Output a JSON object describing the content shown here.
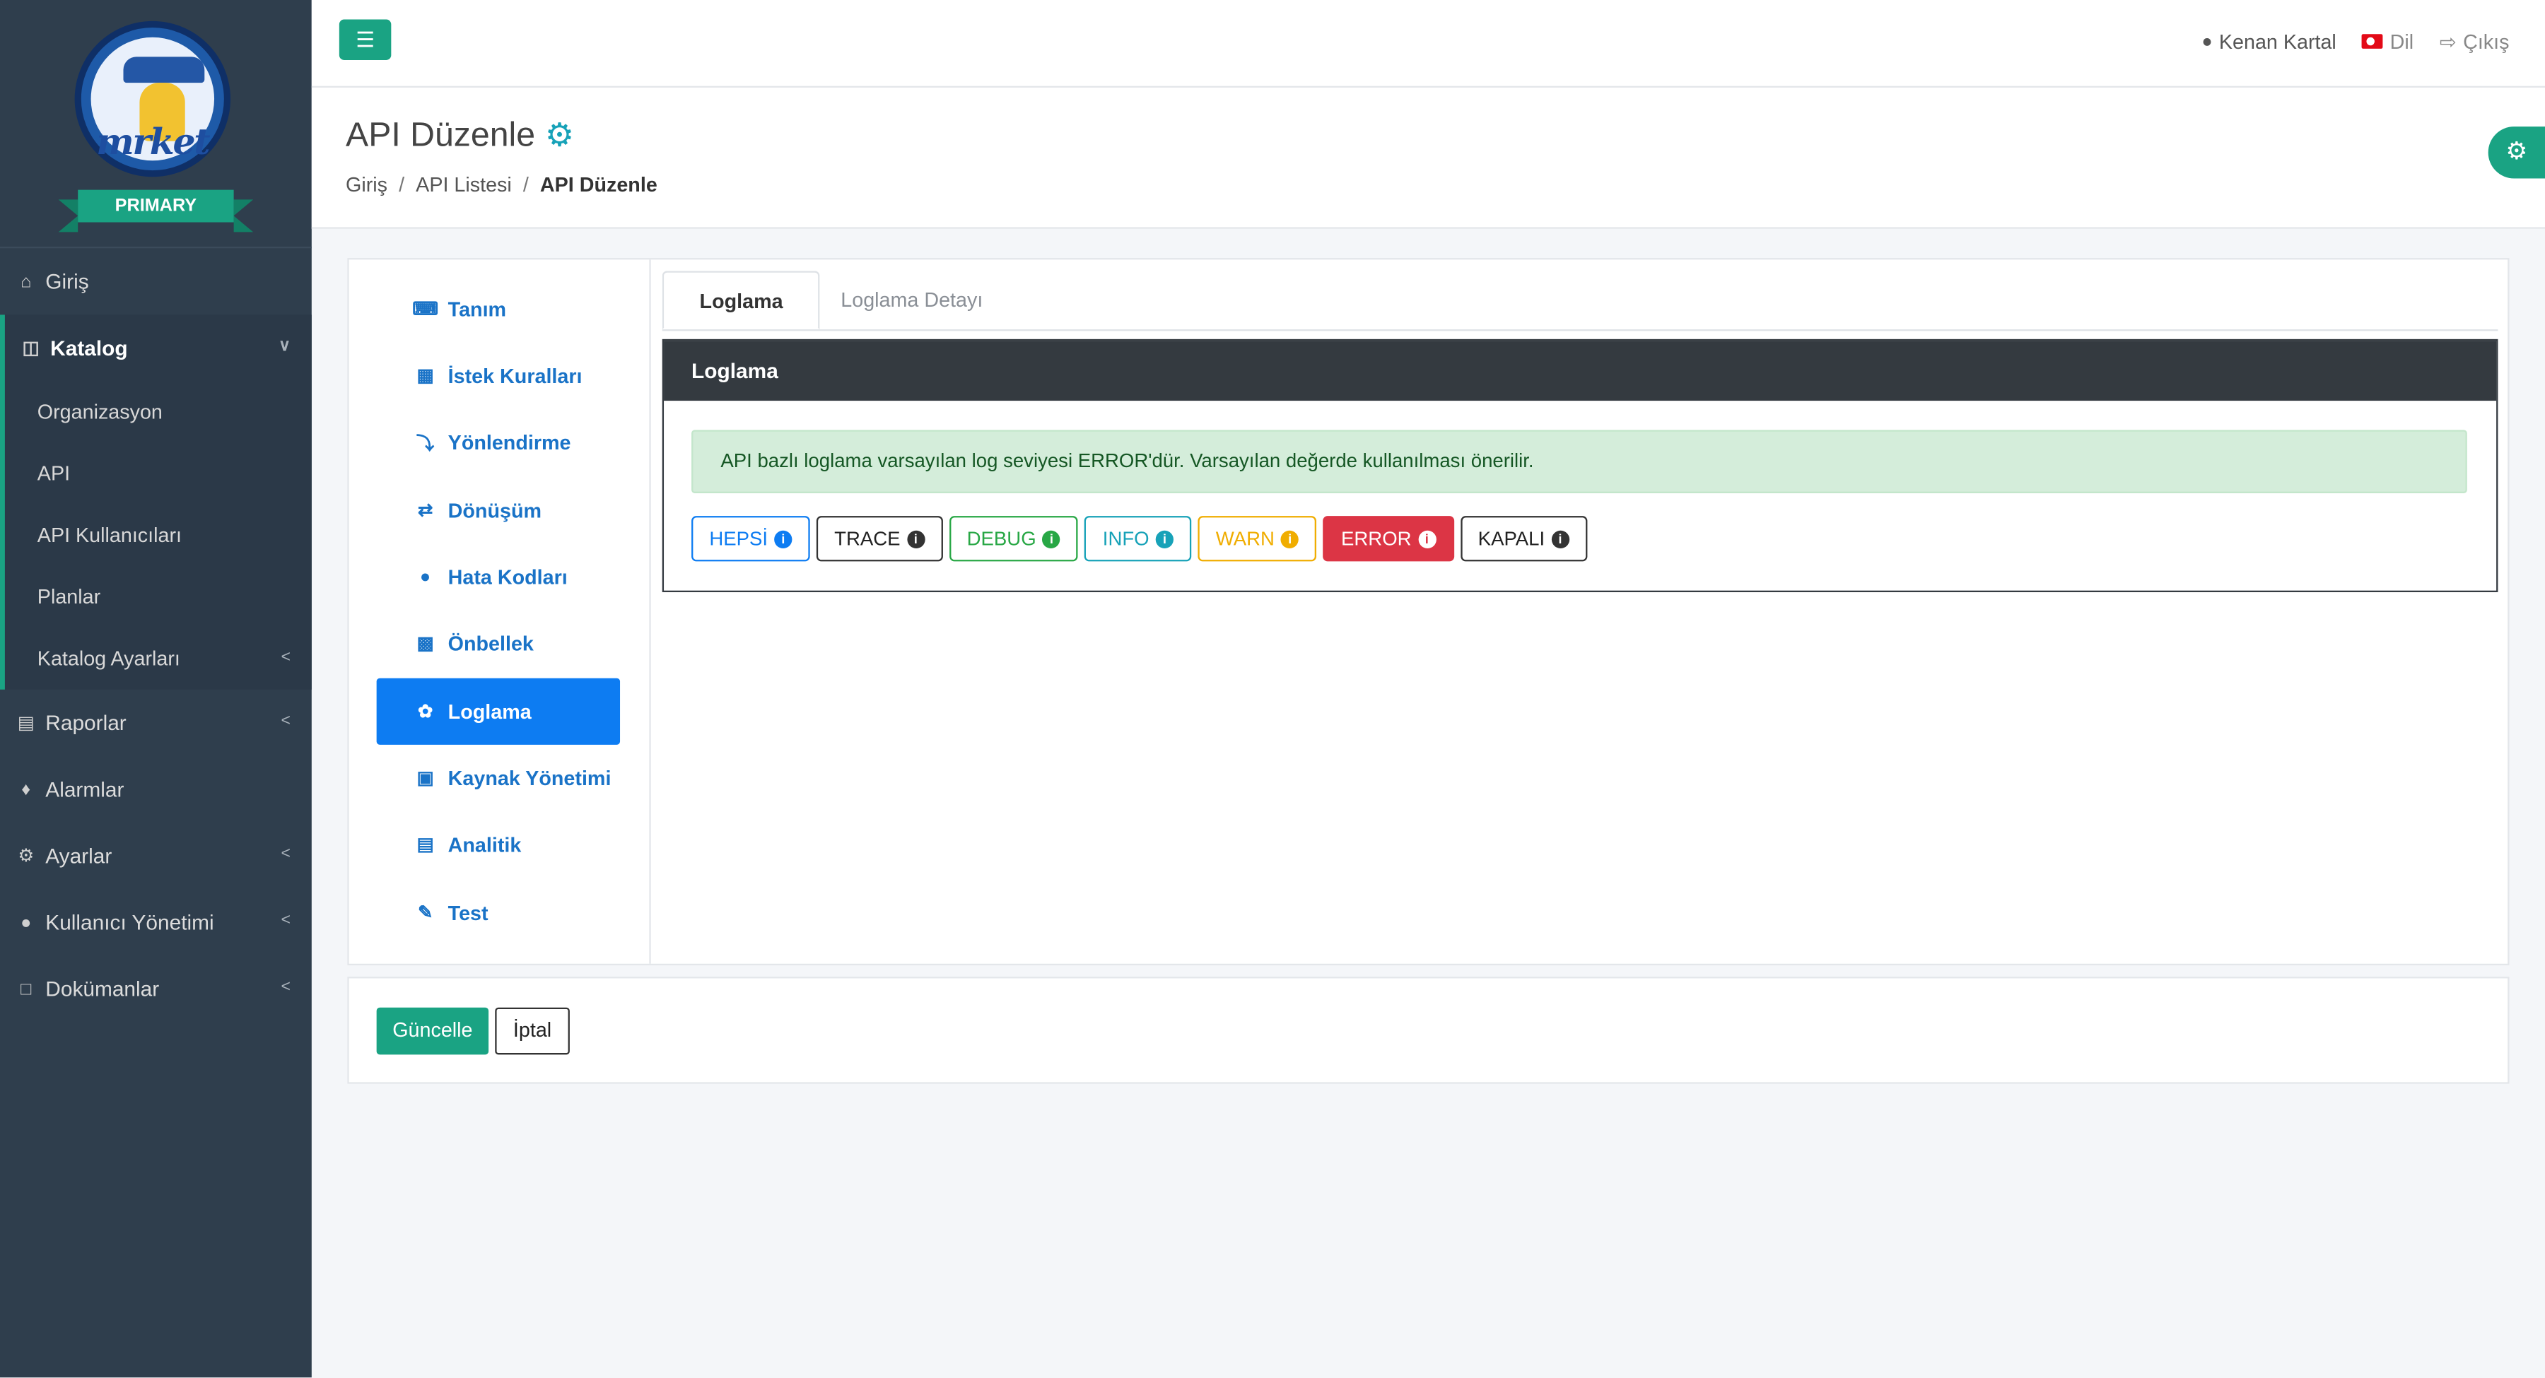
{
  "brand": {
    "logo_text": "mrket",
    "ribbon": "PRIMARY"
  },
  "sidebar": {
    "items": [
      {
        "label": "Giriş",
        "icon": "home-icon"
      },
      {
        "label": "Katalog",
        "icon": "sitemap-icon",
        "expanded": true,
        "children": [
          {
            "label": "Organizasyon"
          },
          {
            "label": "API"
          },
          {
            "label": "API Kullanıcıları"
          },
          {
            "label": "Planlar"
          },
          {
            "label": "Katalog Ayarları"
          }
        ]
      },
      {
        "label": "Raporlar",
        "icon": "chart-icon"
      },
      {
        "label": "Alarmlar",
        "icon": "bell-icon"
      },
      {
        "label": "Ayarlar",
        "icon": "cogs-icon"
      },
      {
        "label": "Kullanıcı Yönetimi",
        "icon": "users-icon"
      },
      {
        "label": "Dokümanlar",
        "icon": "file-icon"
      }
    ]
  },
  "topbar": {
    "user": "Kenan Kartal",
    "language": "Dil",
    "logout": "Çıkış"
  },
  "header": {
    "title": "API Düzenle",
    "breadcrumb": [
      "Giriş",
      "API Listesi",
      "API Düzenle"
    ]
  },
  "left_nav": {
    "items": [
      {
        "label": "Tanım",
        "icon": "keyboard-icon"
      },
      {
        "label": "İstek Kuralları",
        "icon": "file-list-icon"
      },
      {
        "label": "Yönlendirme",
        "icon": "bolt-icon"
      },
      {
        "label": "Dönüşüm",
        "icon": "exchange-icon"
      },
      {
        "label": "Hata Kodları",
        "icon": "exclamation-circle-icon"
      },
      {
        "label": "Önbellek",
        "icon": "memory-icon"
      },
      {
        "label": "Loglama",
        "icon": "leaf-icon",
        "active": true
      },
      {
        "label": "Kaynak Yönetimi",
        "icon": "lock-icon"
      },
      {
        "label": "Analitik",
        "icon": "chart-icon"
      },
      {
        "label": "Test",
        "icon": "pencil-icon"
      }
    ]
  },
  "tabs": [
    "Loglama",
    "Loglama Detayı"
  ],
  "panel": {
    "title": "Loglama",
    "alert": "API bazlı loglama varsayılan log seviyesi ERROR'dür. Varsayılan değerde kullanılması önerilir.",
    "levels": [
      "HEPSİ",
      "TRACE",
      "DEBUG",
      "INFO",
      "WARN",
      "ERROR",
      "KAPALI"
    ],
    "selected_level": "ERROR"
  },
  "actions": {
    "update": "Güncelle",
    "cancel": "İptal"
  },
  "colors": {
    "accent": "#1aa383",
    "primary": "#0d7cf2",
    "sidebar_bg": "#2f3e4d",
    "danger": "#dc3545"
  }
}
